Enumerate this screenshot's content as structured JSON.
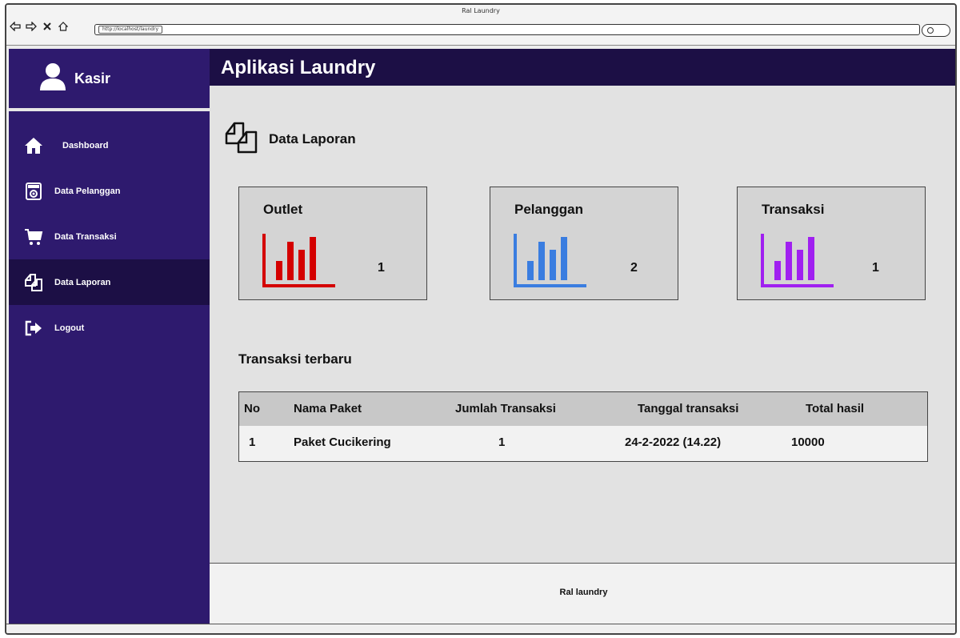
{
  "window": {
    "title": "Ral Laundry",
    "url": "http://localhost/laundry"
  },
  "sidebar": {
    "user_label": "Kasir",
    "items": [
      {
        "label": "Dashboard",
        "icon": "home-icon",
        "active": false
      },
      {
        "label": "Data Pelanggan",
        "icon": "customer-badge-icon",
        "active": false
      },
      {
        "label": "Data Transaksi",
        "icon": "cart-icon",
        "active": false
      },
      {
        "label": "Data Laporan",
        "icon": "report-icon",
        "active": true
      },
      {
        "label": "Logout",
        "icon": "logout-icon",
        "active": false
      }
    ]
  },
  "header": {
    "title": "Aplikasi Laundry"
  },
  "main": {
    "section_title": "Data Laporan",
    "cards": [
      {
        "label": "Outlet",
        "count": "1",
        "color": "#d40000"
      },
      {
        "label": "Pelanggan",
        "count": "2",
        "color": "#3a7de0"
      },
      {
        "label": "Transaksi",
        "count": "1",
        "color": "#a020f0"
      }
    ],
    "recent_title": "Transaksi terbaru",
    "table": {
      "headers": [
        "No",
        "Nama Paket",
        "Jumlah Transaksi",
        "Tanggal transaksi",
        "Total hasil"
      ],
      "rows": [
        [
          "1",
          "Paket Cucikering",
          "1",
          "24-2-2022 (14.22)",
          "10000"
        ]
      ]
    }
  },
  "footer": {
    "text": "Ral laundry"
  },
  "colors": {
    "sidebar": "#2e1a6e",
    "header": "#1c0f45",
    "active_item": "#1c0f45"
  }
}
